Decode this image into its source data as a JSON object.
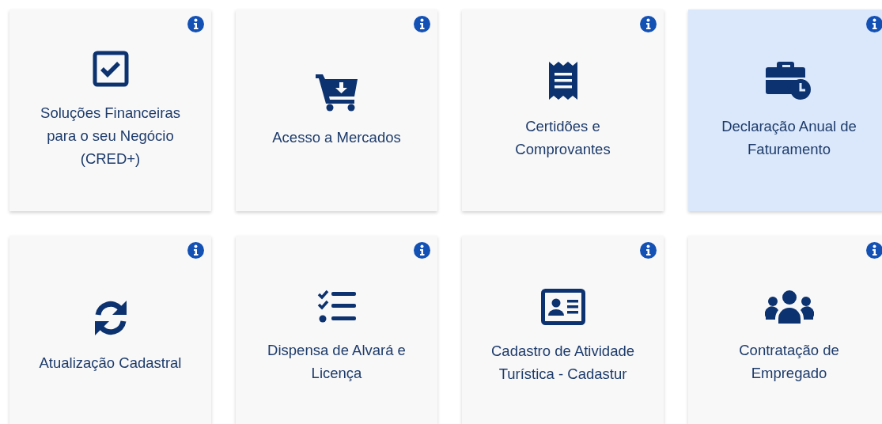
{
  "cards": [
    {
      "title": "Soluções Financeiras para o seu Negócio (CRED+)",
      "kind": "checkbox",
      "selected": false
    },
    {
      "title": "Acesso a Mercados",
      "kind": "cart",
      "selected": false
    },
    {
      "title": "Certidões e Comprovantes",
      "kind": "receipt",
      "selected": false
    },
    {
      "title": "Declaração Anual de Faturamento",
      "kind": "briefcase",
      "selected": true
    },
    {
      "title": "Atualização Cadastral",
      "kind": "sync",
      "selected": false
    },
    {
      "title": "Dispensa de Alvará e Licença",
      "kind": "tasks",
      "selected": false
    },
    {
      "title": "Cadastro de Atividade Turística - Cadastur",
      "kind": "idcard",
      "selected": false
    },
    {
      "title": "Contratação de Empregado",
      "kind": "users",
      "selected": false
    }
  ]
}
